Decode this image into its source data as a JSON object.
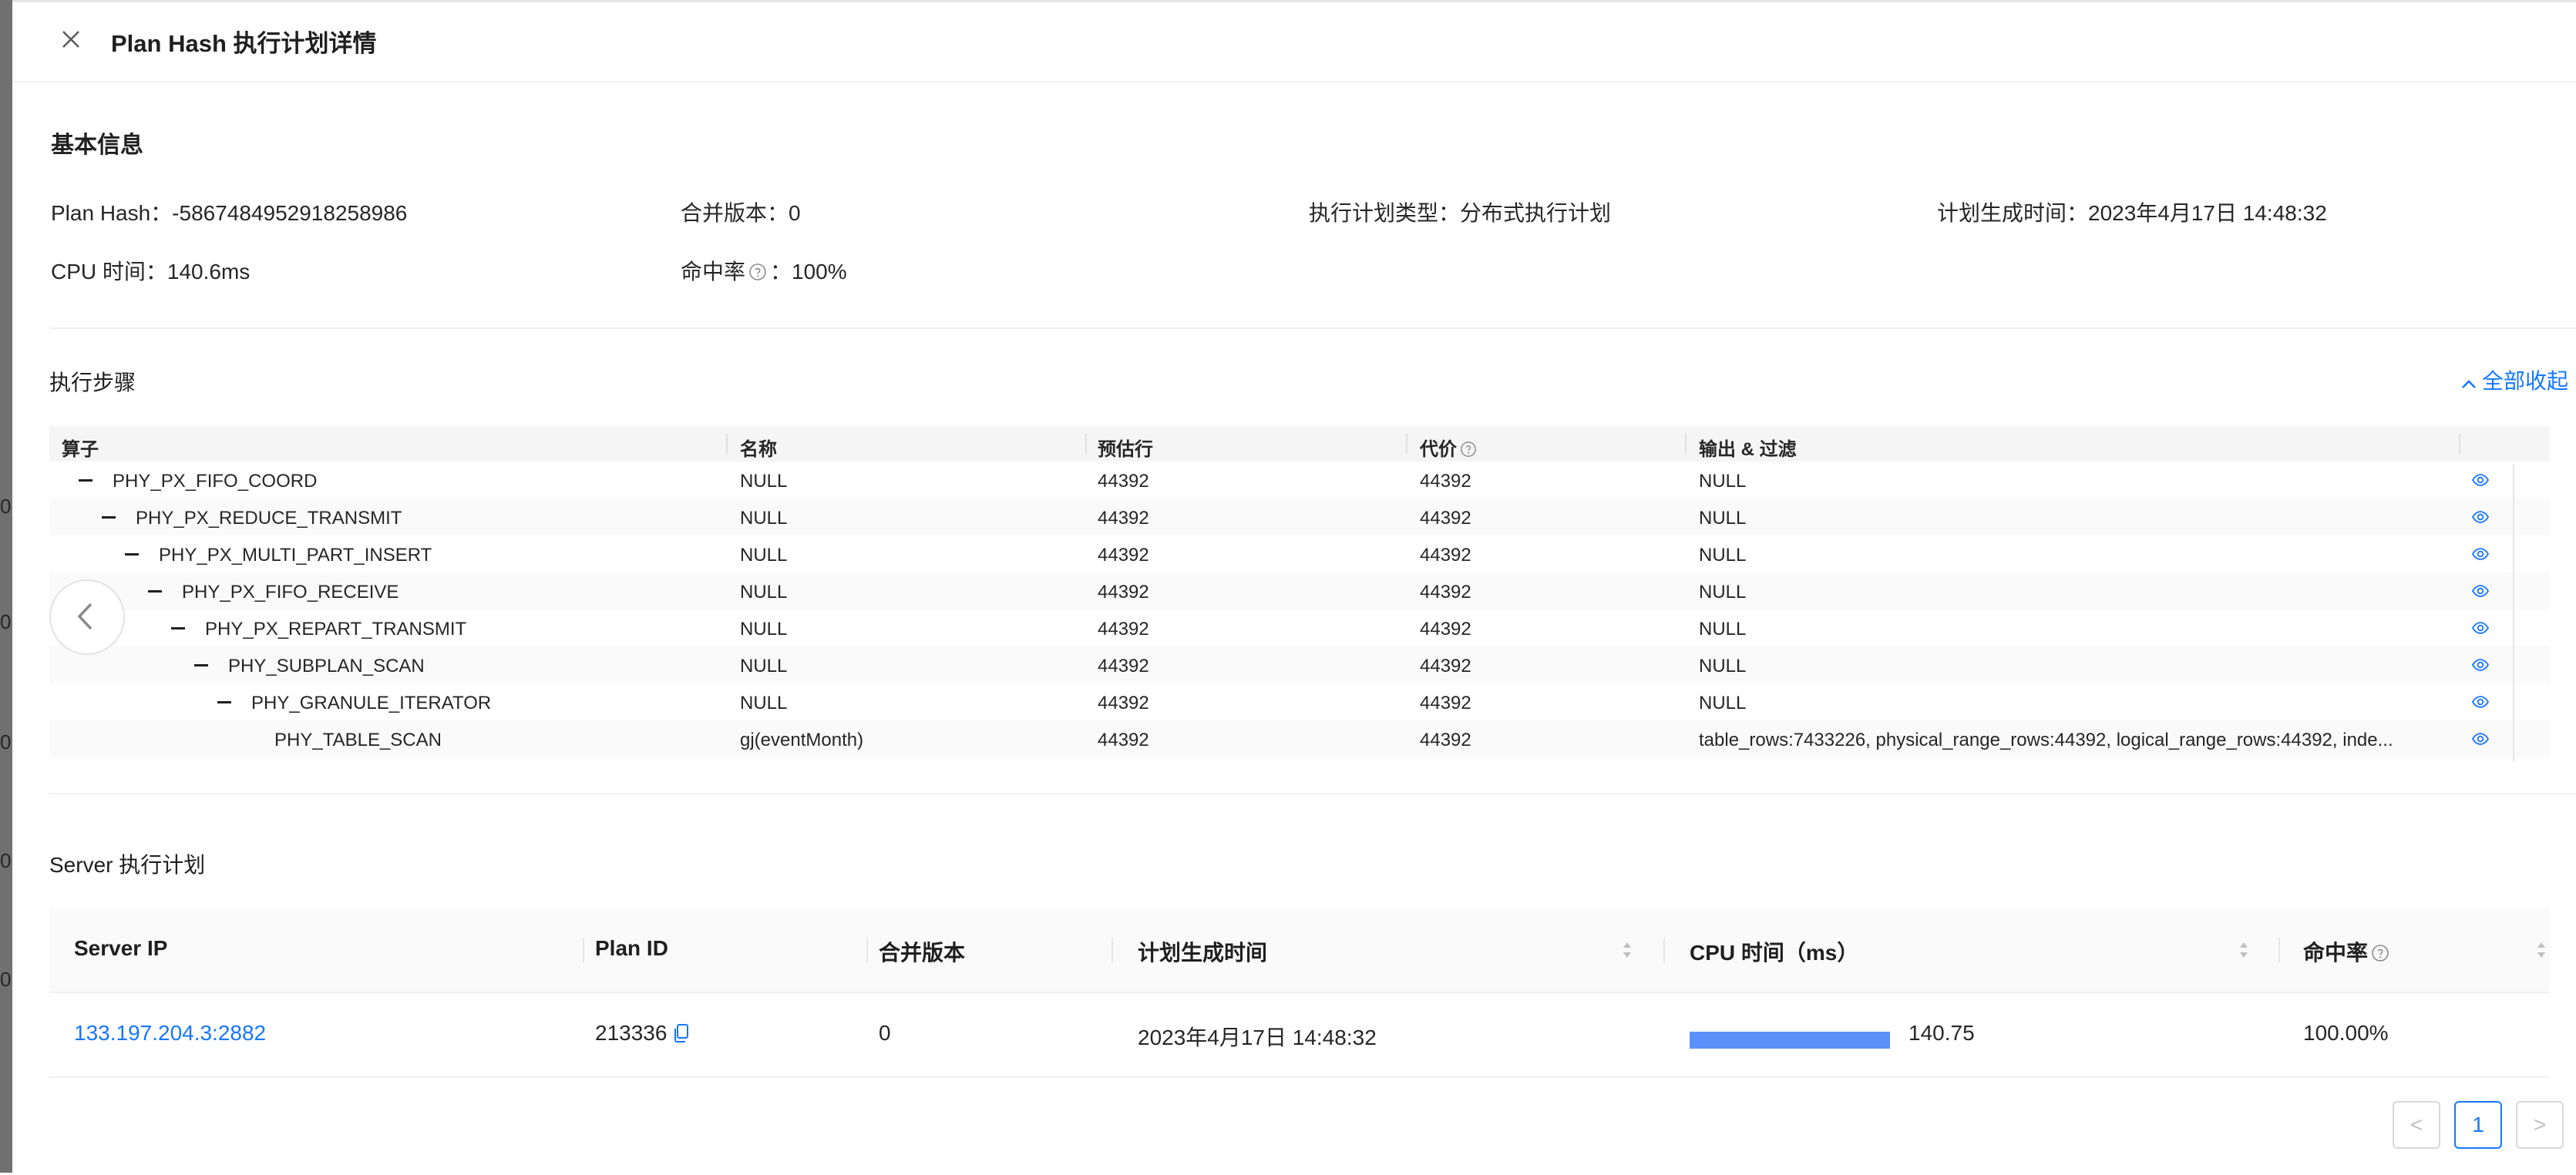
{
  "drawer": {
    "title": "Plan Hash 执行计划详情"
  },
  "edge_labels": [
    "0",
    "0",
    "0",
    "0",
    "0"
  ],
  "basic_info": {
    "title": "基本信息",
    "plan_hash": "Plan Hash：-5867484952918258986",
    "merge_version": "合并版本：0",
    "plan_type": "执行计划类型：分布式执行计划",
    "gen_time": "计划生成时间：2023年4月17日 14:48:32",
    "cpu_time": "CPU 时间：140.6ms",
    "hit_rate_label": "命中率",
    "hit_rate_value": "：100%"
  },
  "steps": {
    "title": "执行步骤",
    "collapse_all": "全部收起",
    "headers": {
      "operator": "算子",
      "name": "名称",
      "est_rows": "预估行",
      "cost": "代价",
      "output": "输出 & 过滤"
    },
    "rows": [
      {
        "operator": "PHY_PX_FIFO_COORD",
        "name": "NULL",
        "est_rows": "44392",
        "cost": "44392",
        "output": "NULL"
      },
      {
        "operator": "PHY_PX_REDUCE_TRANSMIT",
        "name": "NULL",
        "est_rows": "44392",
        "cost": "44392",
        "output": "NULL"
      },
      {
        "operator": "PHY_PX_MULTI_PART_INSERT",
        "name": "NULL",
        "est_rows": "44392",
        "cost": "44392",
        "output": "NULL"
      },
      {
        "operator": "PHY_PX_FIFO_RECEIVE",
        "name": "NULL",
        "est_rows": "44392",
        "cost": "44392",
        "output": "NULL"
      },
      {
        "operator": "PHY_PX_REPART_TRANSMIT",
        "name": "NULL",
        "est_rows": "44392",
        "cost": "44392",
        "output": "NULL"
      },
      {
        "operator": "PHY_SUBPLAN_SCAN",
        "name": "NULL",
        "est_rows": "44392",
        "cost": "44392",
        "output": "NULL"
      },
      {
        "operator": "PHY_GRANULE_ITERATOR",
        "name": "NULL",
        "est_rows": "44392",
        "cost": "44392",
        "output": "NULL"
      },
      {
        "operator": "PHY_TABLE_SCAN",
        "name": "gj(eventMonth)",
        "est_rows": "44392",
        "cost": "44392",
        "output": "table_rows:7433226, physical_range_rows:44392, logical_range_rows:44392, inde..."
      }
    ]
  },
  "server_plan": {
    "title": "Server 执行计划",
    "headers": {
      "server_ip": "Server IP",
      "plan_id": "Plan ID",
      "merge_version": "合并版本",
      "gen_time": "计划生成时间",
      "cpu_time": "CPU 时间（ms）",
      "hit_rate": "命中率"
    },
    "rows": [
      {
        "server_ip": "133.197.204.3:2882",
        "plan_id": "213336",
        "merge_version": "0",
        "gen_time": "2023年4月17日 14:48:32",
        "cpu_time": "140.75",
        "cpu_fraction": 1.0,
        "hit_rate": "100.00%"
      }
    ]
  },
  "pagination": {
    "prev": "<",
    "current": "1",
    "next": ">"
  },
  "colors": {
    "accent": "#1677ff",
    "bar": "#5b8ff9"
  }
}
